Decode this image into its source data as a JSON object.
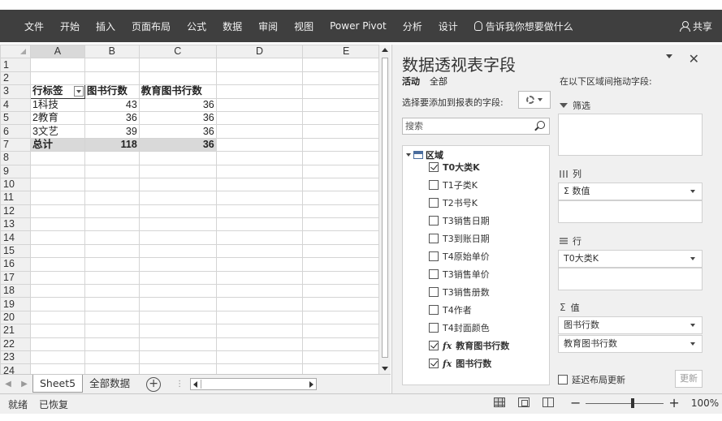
{
  "ribbon": {
    "tabs": [
      "文件",
      "开始",
      "插入",
      "页面布局",
      "公式",
      "数据",
      "审阅",
      "视图",
      "Power Pivot",
      "分析",
      "设计"
    ],
    "tell_me": "告诉我你想要做什么",
    "share": "共享"
  },
  "grid": {
    "columns": [
      "A",
      "B",
      "C",
      "D",
      "E"
    ],
    "rows": [
      "1",
      "2",
      "3",
      "4",
      "5",
      "6",
      "7",
      "8",
      "9",
      "10",
      "11",
      "12",
      "13",
      "14",
      "15",
      "16",
      "17",
      "18",
      "19",
      "20",
      "21",
      "22",
      "23",
      "24"
    ],
    "header": {
      "label": "行标签",
      "col_b": "图书行数",
      "col_c": "教育图书行数"
    },
    "data": [
      {
        "label": "1科技",
        "b": "43",
        "c": "36"
      },
      {
        "label": "2教育",
        "b": "36",
        "c": "36"
      },
      {
        "label": "3文艺",
        "b": "39",
        "c": "36"
      }
    ],
    "total": {
      "label": "总计",
      "b": "118",
      "c": "36"
    }
  },
  "sheets": {
    "tab1": "Sheet5",
    "tab2": "全部数据"
  },
  "status": {
    "ready": "就绪",
    "recovered": "已恢复",
    "zoom": "100%"
  },
  "pane": {
    "title": "数据透视表字段",
    "tab_active": "活动",
    "tab_all": "全部",
    "choose_label": "选择要添加到报表的字段:",
    "search_placeholder": "搜索",
    "tree_root": "区域",
    "fields": [
      {
        "name": "T0大类K",
        "checked": true,
        "calc": false,
        "bold": true
      },
      {
        "name": "T1子类K",
        "checked": false,
        "calc": false,
        "bold": false
      },
      {
        "name": "T2书号K",
        "checked": false,
        "calc": false,
        "bold": false
      },
      {
        "name": "T3销售日期",
        "checked": false,
        "calc": false,
        "bold": false
      },
      {
        "name": "T3到账日期",
        "checked": false,
        "calc": false,
        "bold": false
      },
      {
        "name": "T4原始单价",
        "checked": false,
        "calc": false,
        "bold": false
      },
      {
        "name": "T3销售单价",
        "checked": false,
        "calc": false,
        "bold": false
      },
      {
        "name": "T3销售册数",
        "checked": false,
        "calc": false,
        "bold": false
      },
      {
        "name": "T4作者",
        "checked": false,
        "calc": false,
        "bold": false
      },
      {
        "name": "T4封面颜色",
        "checked": false,
        "calc": false,
        "bold": false
      },
      {
        "name": "教育图书行数",
        "checked": true,
        "calc": true,
        "bold": true
      },
      {
        "name": "图书行数",
        "checked": true,
        "calc": true,
        "bold": true
      }
    ],
    "drag_hint": "在以下区域间拖动字段:",
    "filter_label": "筛选",
    "columns_label": "列",
    "columns_item": "Σ 数值",
    "rows_label": "行",
    "rows_item": "T0大类K",
    "values_label": "值",
    "values_items": [
      "图书行数",
      "教育图书行数"
    ],
    "defer_label": "延迟布局更新",
    "update_label": "更新"
  }
}
